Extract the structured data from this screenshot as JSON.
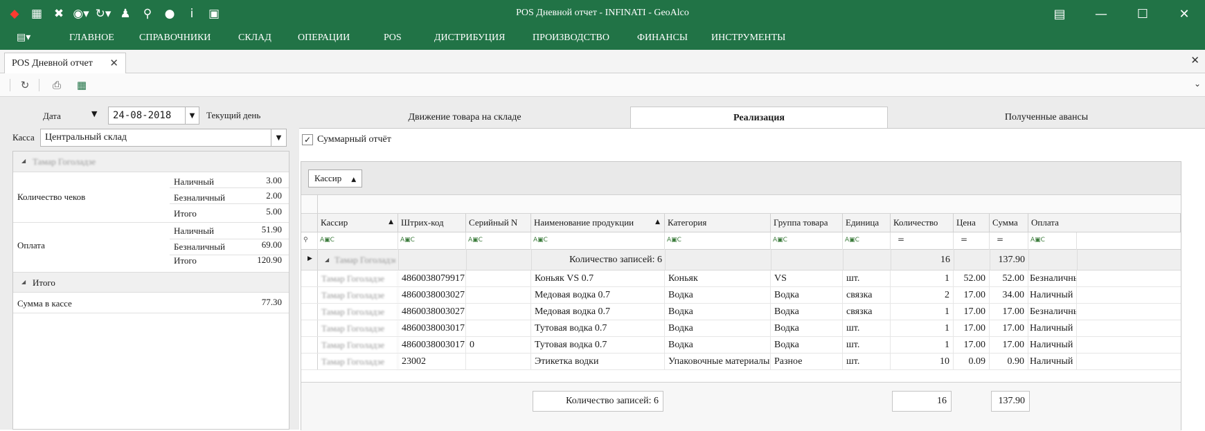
{
  "window": {
    "title": "POS Дневной отчет - INFINATI - GeoAlco",
    "quick_access_icons": [
      "app-logo-icon",
      "calendar-icon",
      "tools-icon",
      "palette-icon",
      "refresh-icon",
      "user-icon",
      "search-icon",
      "chat-bubble-icon",
      "info-icon",
      "message-icon"
    ],
    "window_buttons": [
      "restore-panel-icon",
      "minimize-icon",
      "maximize-icon",
      "close-icon"
    ]
  },
  "menu": {
    "items": [
      "ГЛАВНОЕ",
      "СПРАВОЧНИКИ",
      "СКЛАД",
      "ОПЕРАЦИИ",
      "POS",
      "ДИСТРИБУЦИЯ",
      "ПРОИЗВОДСТВО",
      "ФИНАНСЫ",
      "ИНСТРУМЕНТЫ"
    ]
  },
  "doc_tab": {
    "label": "POS Дневной отчет"
  },
  "filters": {
    "date_label": "Дата",
    "date_value": "24-08-2018",
    "current_day_label": "Текущий день",
    "kassa_label": "Касса",
    "kassa_value": "Центральный склад"
  },
  "summary": {
    "group1_name": "Тамар Гоголадзе",
    "checks_label": "Количество чеков",
    "payment_label": "Оплата",
    "cash_label": "Наличный",
    "noncash_label": "Безналичный",
    "total_label": "Итого",
    "checks_cash": "3.00",
    "checks_noncash": "2.00",
    "checks_total": "5.00",
    "pay_cash": "51.90",
    "pay_noncash": "69.00",
    "pay_total": "120.90",
    "group2_name": "Итого",
    "cash_in_box_label": "Сумма в кассе",
    "cash_in_box_value": "77.30"
  },
  "tabs": [
    "Движение товара на складе",
    "Реализация",
    "Полученные авансы"
  ],
  "active_tab": "Реализация",
  "summary_report_label": "Суммарный отчёт",
  "grid": {
    "group_by_label": "Кассир",
    "columns": [
      "Кассир",
      "Штрих-код",
      "Серийный N",
      "Наименование продукции",
      "Категория",
      "Группа товара",
      "Единица",
      "Количество",
      "Цена",
      "Сумма",
      "Оплата"
    ],
    "group_row": {
      "name": "Тамар Гоголадзе",
      "records": "Количество записей: 6",
      "qty": "16",
      "sum": "137.90"
    },
    "rows": [
      [
        "Тамар Гоголадзе",
        "4860038079917",
        "",
        "Коньяк VS 0.7",
        "Коньяк",
        "VS",
        "шт.",
        "1",
        "52.00",
        "52.00",
        "Безналичный"
      ],
      [
        "Тамар Гоголадзе",
        "4860038003027",
        "",
        "Медовая водка 0.7",
        "Водка",
        "Водка",
        "связка",
        "2",
        "17.00",
        "34.00",
        "Наличный"
      ],
      [
        "Тамар Гоголадзе",
        "4860038003027",
        "",
        "Медовая водка 0.7",
        "Водка",
        "Водка",
        "связка",
        "1",
        "17.00",
        "17.00",
        "Безналичный"
      ],
      [
        "Тамар Гоголадзе",
        "4860038003017",
        "",
        "Тутовая водка 0.7",
        "Водка",
        "Водка",
        "шт.",
        "1",
        "17.00",
        "17.00",
        "Наличный"
      ],
      [
        "Тамар Гоголадзе",
        "4860038003017",
        "0",
        "Тутовая водка 0.7",
        "Водка",
        "Водка",
        "шт.",
        "1",
        "17.00",
        "17.00",
        "Наличный"
      ],
      [
        "Тамар Гоголадзе",
        "23002",
        "",
        "Этикетка водки",
        "Упаковочные материалы",
        "Разное",
        "шт.",
        "10",
        "0.09",
        "0.90",
        "Наличный"
      ]
    ],
    "footer": {
      "records": "Количество записей: 6",
      "qty": "16",
      "sum": "137.90"
    }
  }
}
